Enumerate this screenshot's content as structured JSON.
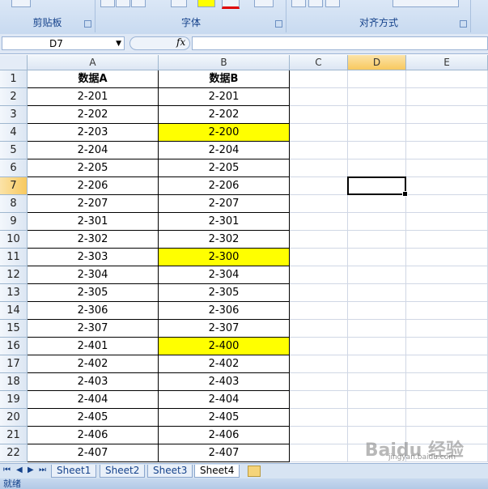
{
  "ribbon": {
    "groups": [
      {
        "label": "剪贴板"
      },
      {
        "label": "字体"
      },
      {
        "label": "对齐方式"
      }
    ]
  },
  "formula_bar": {
    "name_box": "D7",
    "fx_label": "fx",
    "value": ""
  },
  "columns": [
    "A",
    "B",
    "C",
    "D",
    "E"
  ],
  "rows": [
    {
      "num": "1",
      "a": "数据A",
      "b": "数据B",
      "header": true
    },
    {
      "num": "2",
      "a": "2-201",
      "b": "2-201"
    },
    {
      "num": "3",
      "a": "2-202",
      "b": "2-202"
    },
    {
      "num": "4",
      "a": "2-203",
      "b": "2-200",
      "highlight": true
    },
    {
      "num": "5",
      "a": "2-204",
      "b": "2-204"
    },
    {
      "num": "6",
      "a": "2-205",
      "b": "2-205"
    },
    {
      "num": "7",
      "a": "2-206",
      "b": "2-206"
    },
    {
      "num": "8",
      "a": "2-207",
      "b": "2-207"
    },
    {
      "num": "9",
      "a": "2-301",
      "b": "2-301"
    },
    {
      "num": "10",
      "a": "2-302",
      "b": "2-302"
    },
    {
      "num": "11",
      "a": "2-303",
      "b": "2-300",
      "highlight": true
    },
    {
      "num": "12",
      "a": "2-304",
      "b": "2-304"
    },
    {
      "num": "13",
      "a": "2-305",
      "b": "2-305"
    },
    {
      "num": "14",
      "a": "2-306",
      "b": "2-306"
    },
    {
      "num": "15",
      "a": "2-307",
      "b": "2-307"
    },
    {
      "num": "16",
      "a": "2-401",
      "b": "2-400",
      "highlight": true
    },
    {
      "num": "17",
      "a": "2-402",
      "b": "2-402"
    },
    {
      "num": "18",
      "a": "2-403",
      "b": "2-403"
    },
    {
      "num": "19",
      "a": "2-404",
      "b": "2-404"
    },
    {
      "num": "20",
      "a": "2-405",
      "b": "2-405"
    },
    {
      "num": "21",
      "a": "2-406",
      "b": "2-406"
    },
    {
      "num": "22",
      "a": "2-407",
      "b": "2-407"
    }
  ],
  "selected_cell": {
    "col": "D",
    "row": "7"
  },
  "sheets": [
    {
      "label": "Sheet1",
      "active": false
    },
    {
      "label": "Sheet2",
      "active": false
    },
    {
      "label": "Sheet3",
      "active": false
    },
    {
      "label": "Sheet4",
      "active": true
    }
  ],
  "status_text": "就绪",
  "watermark": {
    "text": "Baidu 经验",
    "url": "jingyan.baidu.com"
  },
  "colors": {
    "highlight": "#ffff00",
    "selection": "#000000",
    "header_active": "#f8c95f"
  }
}
